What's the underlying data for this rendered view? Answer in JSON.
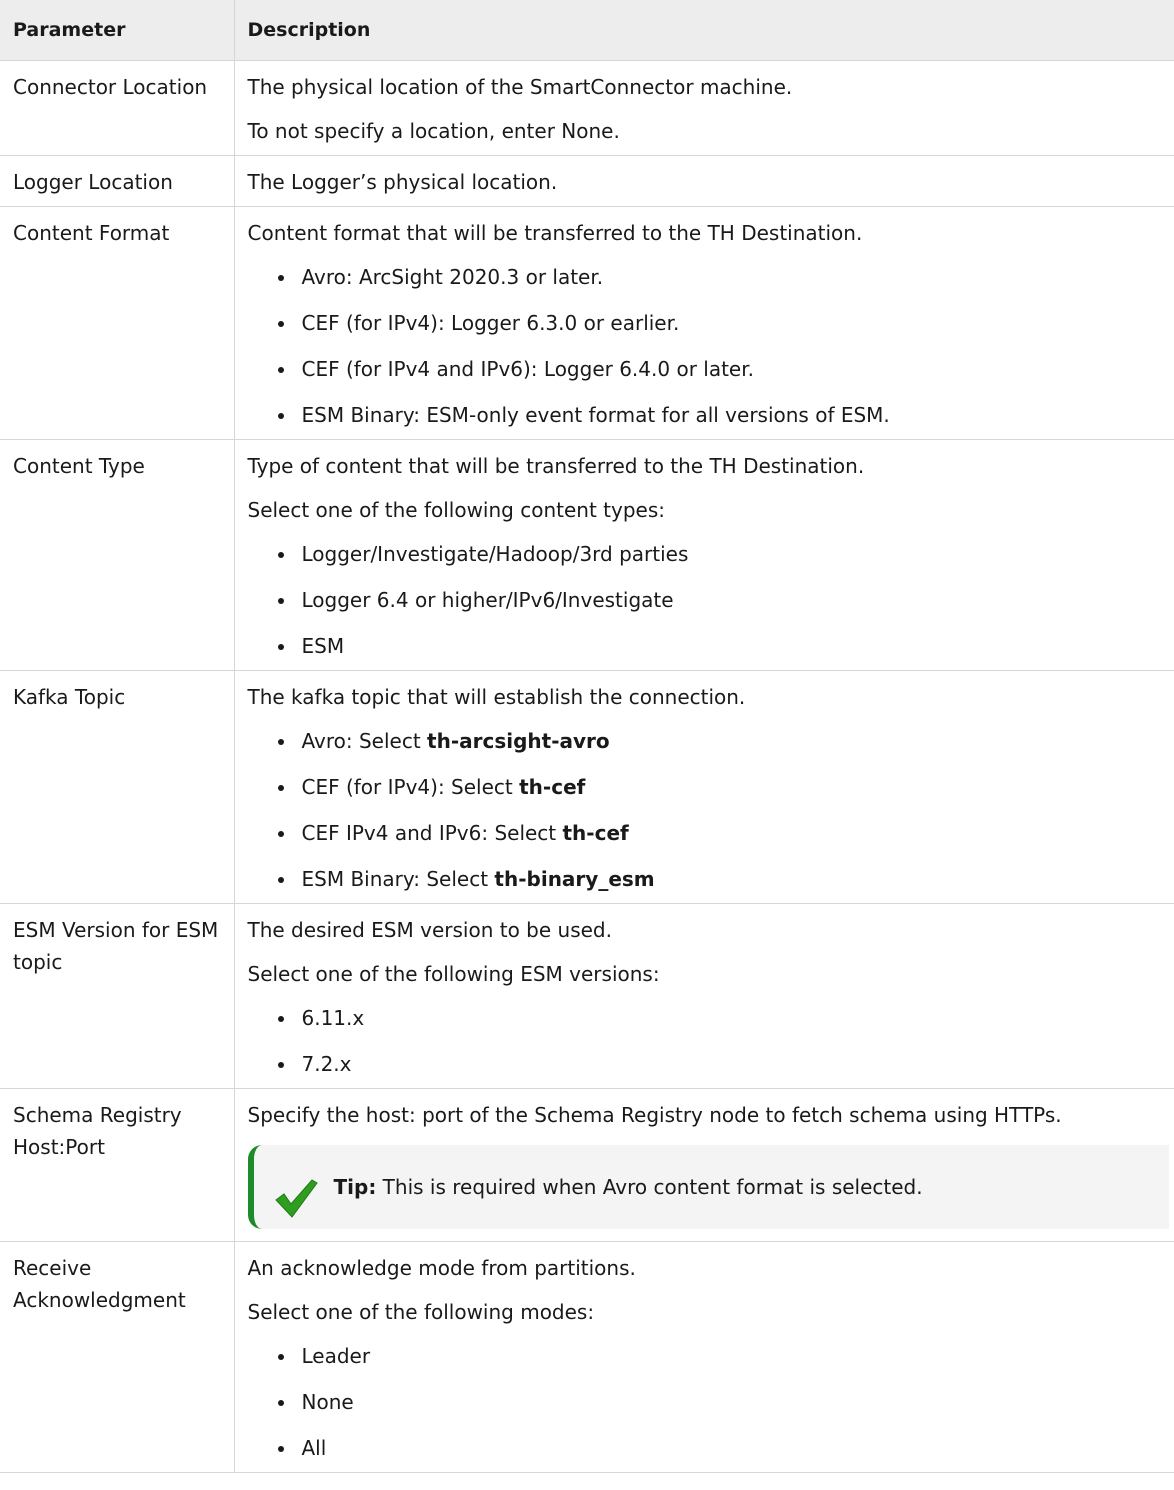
{
  "header": {
    "parameter": "Parameter",
    "description": "Description"
  },
  "rows": {
    "connector_location": {
      "param": "Connector Location",
      "p1": "The physical location of the SmartConnector machine.",
      "p2": "To not specify a location, enter None."
    },
    "logger_location": {
      "param": "Logger Location",
      "p1": "The Logger’s physical location."
    },
    "content_format": {
      "param": "Content Format",
      "p1": "Content format that will be transferred to the TH Destination.",
      "items": [
        "Avro: ArcSight 2020.3 or later.",
        "CEF (for IPv4): Logger 6.3.0 or earlier.",
        "CEF (for IPv4 and IPv6): Logger 6.4.0 or later.",
        "ESM Binary: ESM-only event format for all versions of ESM."
      ]
    },
    "content_type": {
      "param": "Content Type",
      "p1": "Type of content that will be transferred to the TH Destination.",
      "p2": "Select one of the following content types:",
      "items": [
        "Logger/Investigate/Hadoop/3rd parties",
        "Logger 6.4 or higher/IPv6/Investigate",
        "ESM"
      ]
    },
    "kafka_topic": {
      "param": "Kafka Topic",
      "p1": "The kafka topic that will establish the connection.",
      "items": [
        {
          "prefix": "Avro: Select ",
          "bold": "th-arcsight-avro"
        },
        {
          "prefix": "CEF (for IPv4): Select ",
          "bold": "th-cef"
        },
        {
          "prefix": "CEF IPv4 and IPv6: Select ",
          "bold": "th-cef"
        },
        {
          "prefix": "ESM Binary: Select ",
          "bold": "th-binary_esm"
        }
      ]
    },
    "esm_version": {
      "param": "ESM Version for ESM topic",
      "p1": "The desired ESM version to be used.",
      "p2": "Select one of the following ESM versions:",
      "items": [
        "6.11.x",
        "7.2.x"
      ]
    },
    "schema_registry": {
      "param": "Schema Registry Host:Port",
      "p1": "Specify the host: port of the Schema Registry node to fetch schema using HTTPs.",
      "tip_label": "Tip:",
      "tip_text": " This is required when Avro content format is selected."
    },
    "receive_ack": {
      "param": "Receive Acknowledgment",
      "p1": "An acknowledge mode from partitions.",
      "p2": "Select one of the following modes:",
      "items": [
        "Leader",
        "None",
        "All"
      ]
    }
  },
  "colors": {
    "header_bg": "#ededed",
    "border": "#d6d6d6",
    "tip_accent": "#1d8b2a",
    "check": "#2f9e1f"
  },
  "icons": {
    "tip": "checkmark-icon"
  }
}
